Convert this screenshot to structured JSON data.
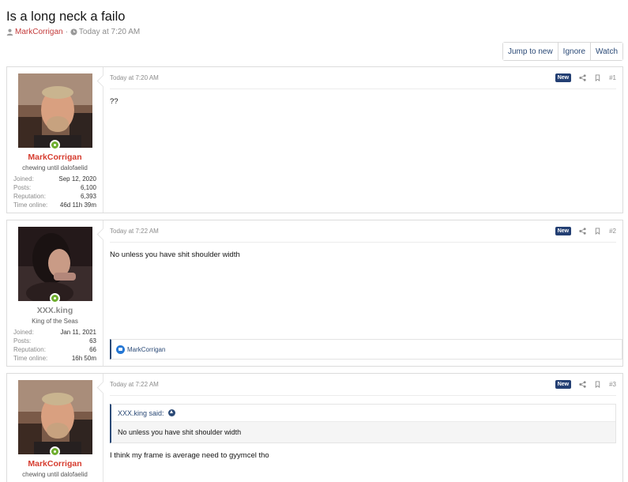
{
  "thread": {
    "title": "Is a long neck a failo",
    "author": "MarkCorrigan",
    "separator": "·",
    "time": "Today at 7:20 AM"
  },
  "toolbar": {
    "jump_to_new": "Jump to new",
    "ignore": "Ignore",
    "watch": "Watch"
  },
  "posts": [
    {
      "username": "MarkCorrigan",
      "usertitle": "chewing until dalofaelid",
      "stats": [
        {
          "label": "Joined:",
          "value": "Sep 12, 2020"
        },
        {
          "label": "Posts:",
          "value": "6,100"
        },
        {
          "label": "Reputation:",
          "value": "6,393"
        },
        {
          "label": "Time online:",
          "value": "46d 11h 39m"
        }
      ],
      "time": "Today at 7:20 AM",
      "badge": "New",
      "number": "#1",
      "body": "??"
    },
    {
      "username": "XXX.king",
      "usertitle": "King of the Seas",
      "stats": [
        {
          "label": "Joined:",
          "value": "Jan 11, 2021"
        },
        {
          "label": "Posts:",
          "value": "63"
        },
        {
          "label": "Reputation:",
          "value": "66"
        },
        {
          "label": "Time online:",
          "value": "16h 50m"
        }
      ],
      "time": "Today at 7:22 AM",
      "badge": "New",
      "number": "#2",
      "body": "No unless you have shit shoulder width",
      "reaction_user": "MarkCorrigan"
    },
    {
      "username": "MarkCorrigan",
      "usertitle": "chewing until dalofaelid",
      "time": "Today at 7:22 AM",
      "badge": "New",
      "number": "#3",
      "quote_author": "XXX.king said:",
      "quote_body": "No unless you have shit shoulder width",
      "body": "I think my frame is average need to gyymcel tho"
    }
  ],
  "colors": {
    "username_red": "#d63c2f",
    "link_blue": "#2b4a77",
    "online_green": "#6fae2e",
    "badge_navy": "#233f73"
  }
}
